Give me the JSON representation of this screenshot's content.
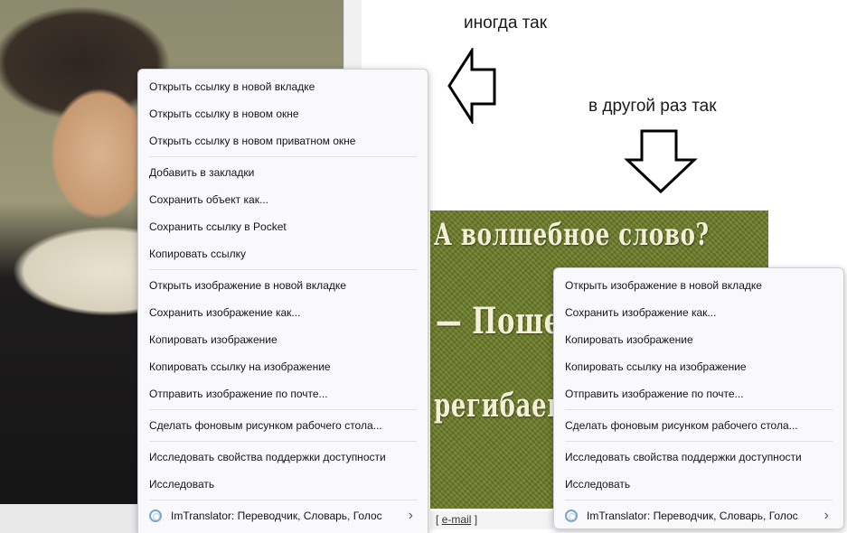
{
  "annotations": {
    "top": "иногда так",
    "middle": "в другой раз так"
  },
  "banner": {
    "line1": "А волшебное слово?",
    "line2": "— Пошел",
    "line3": "регибаешь",
    "link_open": "[",
    "link_text": "e-mail",
    "link_close": "]"
  },
  "menu_left": {
    "group1": [
      "Открыть ссылку в новой вкладке",
      "Открыть ссылку в новом окне",
      "Открыть ссылку в новом приватном окне"
    ],
    "group2": [
      "Добавить в закладки",
      "Сохранить объект как...",
      "Сохранить ссылку в Pocket",
      "Копировать ссылку"
    ],
    "group3": [
      "Открыть изображение в новой вкладке",
      "Сохранить изображение как...",
      "Копировать изображение",
      "Копировать ссылку на изображение",
      "Отправить изображение по почте..."
    ],
    "group4": [
      "Сделать фоновым рисунком рабочего стола..."
    ],
    "group5": [
      "Исследовать свойства поддержки доступности",
      "Исследовать"
    ],
    "translator": "ImTranslator: Переводчик, Словарь, Голос"
  },
  "menu_right": {
    "group1": [
      "Открыть изображение в новой вкладке",
      "Сохранить изображение как...",
      "Копировать изображение",
      "Копировать ссылку на изображение",
      "Отправить изображение по почте..."
    ],
    "group2": [
      "Сделать фоновым рисунком рабочего стола..."
    ],
    "group3": [
      "Исследовать свойства поддержки доступности",
      "Исследовать"
    ],
    "translator": "ImTranslator: Переводчик, Словарь, Голос"
  },
  "icons": {
    "translator": "translator-globe-icon",
    "submenu": "chevron-right-icon",
    "arrow_left": "arrow-left-outline-icon",
    "arrow_down": "arrow-down-outline-icon"
  }
}
